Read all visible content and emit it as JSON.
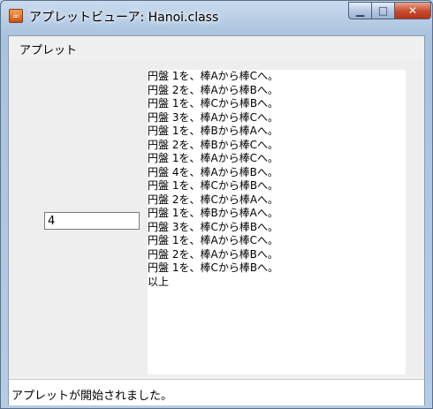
{
  "window": {
    "title": "アプレットビューア: Hanoi.class",
    "icon": "java-applet-icon",
    "buttons": {
      "minimize": "minimize-icon",
      "maximize": "maximize-icon",
      "close": "close-icon"
    }
  },
  "menu": {
    "applet_label": "アプレット"
  },
  "input": {
    "value": "4"
  },
  "output": {
    "lines": [
      "円盤 1を、棒Aから棒Cへ。",
      "円盤 2を、棒Aから棒Bへ。",
      "円盤 1を、棒Cから棒Bへ。",
      "円盤 3を、棒Aから棒Cへ。",
      "円盤 1を、棒Bから棒Aへ。",
      "円盤 2を、棒Bから棒Cへ。",
      "円盤 1を、棒Aから棒Cへ。",
      "円盤 4を、棒Aから棒Bへ。",
      "円盤 1を、棒Cから棒Bへ。",
      "円盤 2を、棒Cから棒Aへ。",
      "円盤 1を、棒Bから棒Aへ。",
      "円盤 3を、棒Cから棒Bへ。",
      "円盤 1を、棒Aから棒Cへ。",
      "円盤 2を、棒Aから棒Bへ。",
      "円盤 1を、棒Cから棒Bへ。",
      "以上"
    ]
  },
  "status": {
    "text": "アプレットが開始されました。"
  }
}
